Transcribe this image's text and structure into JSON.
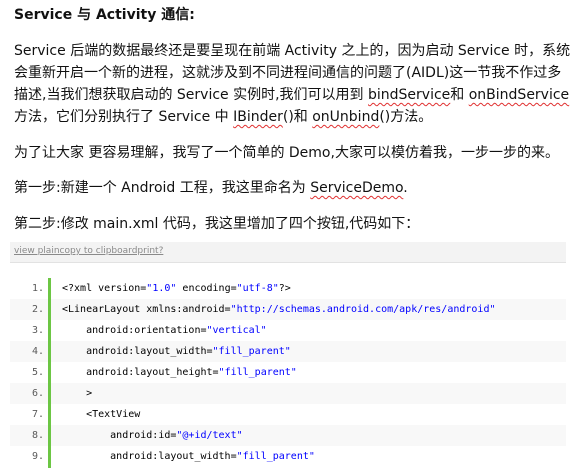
{
  "title": "Service 与 Activity 通信:",
  "paragraphs": {
    "p1_line1": "Service 后端的数据最终还是要呈现在前端 Activity 之上的，因为启动 Service 时，系统",
    "p1_line2": "会重新开启一个新的进程，这就涉及到不同进程间通信的问题了(AIDL)这一节我不作过多",
    "p1_line3_a": "描述,当我们想获取启动的 Service 实例时,我们可以用到 ",
    "p1_line3_b": "bindService",
    "p1_line3_c": "和 ",
    "p1_line3_d": "onBindService",
    "p1_line4_a": "方法，它们分别执行了 Service 中 ",
    "p1_line4_b": "IBinder",
    "p1_line4_c": "()和 ",
    "p1_line4_d": "onUnbind",
    "p1_line4_e": "()方法。",
    "p2": "为了让大家 更容易理解，我写了一个简单的 Demo,大家可以模仿着我，一步一步的来。",
    "p3_a": "第一步:新建一个 Android 工程，我这里命名为 ",
    "p3_b": "ServiceDemo",
    "p3_c": ".",
    "p4": "第二步:修改 main.xml 代码，我这里增加了四个按钮,代码如下："
  },
  "toolbar": {
    "link": "view plaincopy to clipboardprint?"
  },
  "code_lines": [
    {
      "n": "1.",
      "text": "<?xml version=\"1.0\" encoding=\"utf-8\"?>"
    },
    {
      "n": "2.",
      "text": "<LinearLayout xmlns:android=\"http://schemas.android.com/apk/res/android\""
    },
    {
      "n": "3.",
      "text": "    android:orientation=\"vertical\""
    },
    {
      "n": "4.",
      "text": "    android:layout_width=\"fill_parent\""
    },
    {
      "n": "5.",
      "text": "    android:layout_height=\"fill_parent\""
    },
    {
      "n": "6.",
      "text": "    >"
    },
    {
      "n": "7.",
      "text": "    <TextView"
    },
    {
      "n": "8.",
      "text": "        android:id=\"@+id/text\""
    },
    {
      "n": "9.",
      "text": "        android:layout_width=\"fill_parent\""
    }
  ],
  "colors": {
    "gutter_bar": "#6cc644",
    "string": "#0000ff",
    "spellcheck": "#e03030"
  }
}
